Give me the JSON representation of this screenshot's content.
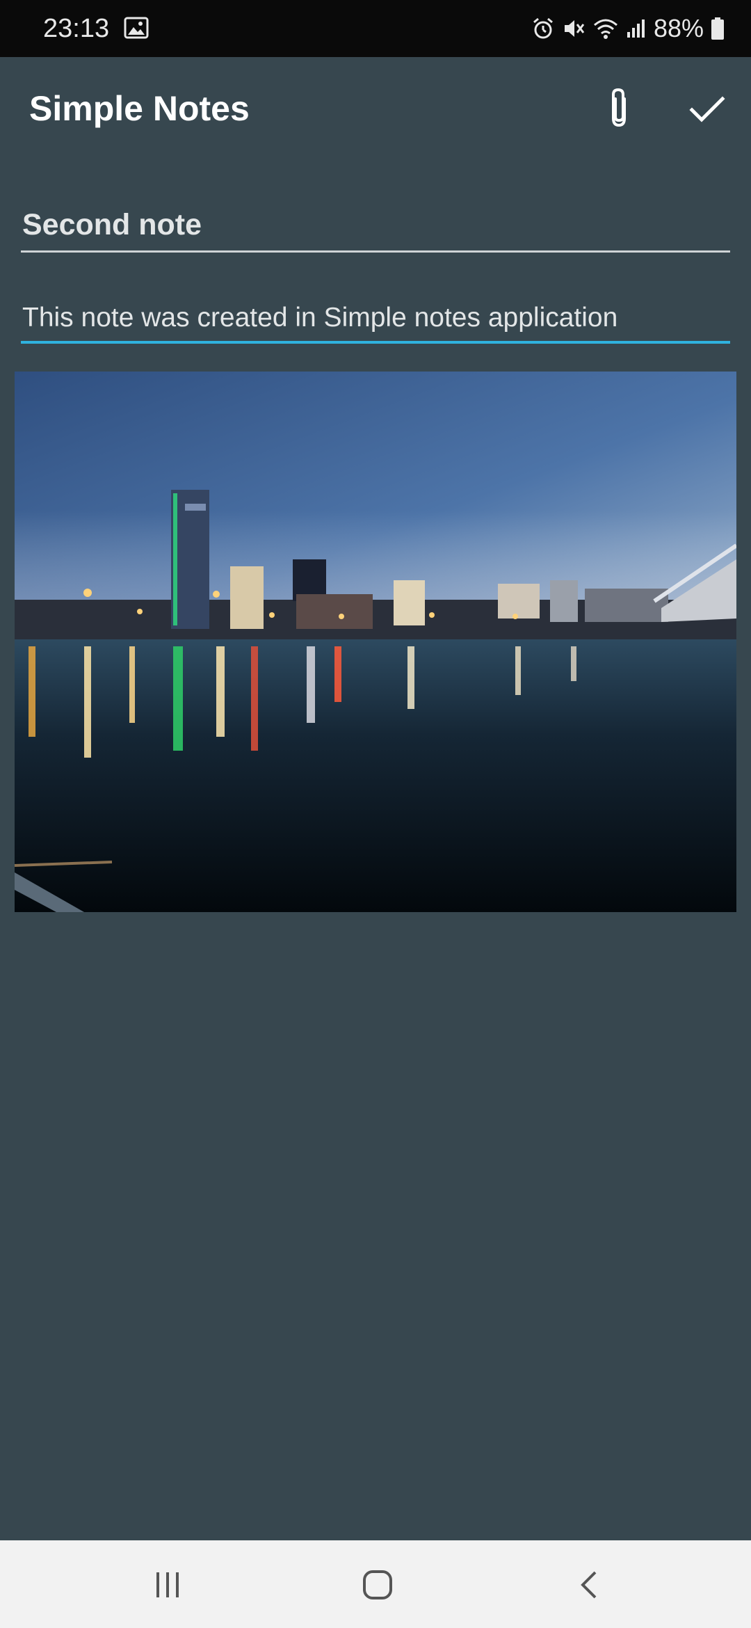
{
  "status_bar": {
    "time": "23:13",
    "battery": "88%",
    "icons": [
      "gallery-icon",
      "alarm-icon",
      "mute-icon",
      "wifi-icon",
      "signal-icon",
      "battery-icon"
    ]
  },
  "toolbar": {
    "title": "Simple Notes",
    "attach_icon": "paperclip-icon",
    "save_icon": "checkmark-icon"
  },
  "note": {
    "title": "Second note",
    "body": "This note was created in Simple notes application",
    "image_description": "Night city skyline with lights reflected in a river"
  },
  "nav_bar": {
    "icons": [
      "recent-apps-icon",
      "home-icon",
      "back-icon"
    ]
  },
  "colors": {
    "background": "#37474f",
    "accent": "#2fb3df",
    "status_bar": "#0a0a0a",
    "nav_bar": "#f2f2f2"
  }
}
